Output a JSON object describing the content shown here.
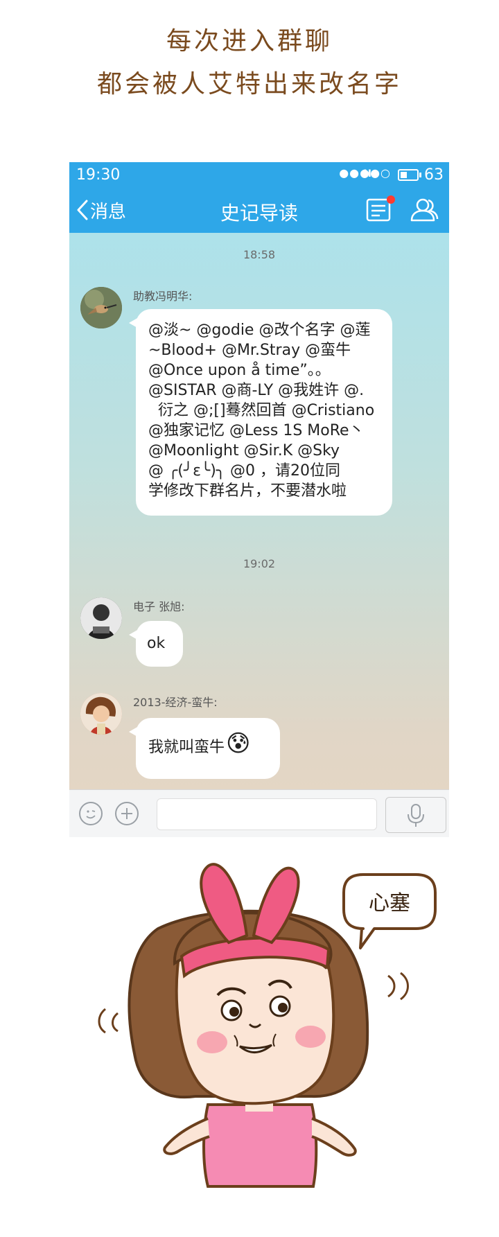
{
  "caption": {
    "line1": "每次进入群聊",
    "line2": "都会被人艾特出来改名字"
  },
  "status_bar": {
    "time": "19:30",
    "network": "H",
    "battery": "63"
  },
  "nav": {
    "back_label": "消息",
    "title": "史记导读",
    "icons": [
      "chevron-left-icon",
      "group-notice-icon",
      "group-members-icon"
    ]
  },
  "messages": [
    {
      "timestamp": "18:58",
      "sender": "助教冯明华:",
      "text": "@淡~ @godie @改个名字 @莲\n~Blood+ @Mr.Stray @蛮牛\n@Once upon å time”。。\n@SISTAR @商-LY @我姓许 @.\n  衍之 @;[]蓦然回首 @Cristiano\n@独家记忆 @Less 1S MoRe丶\n@Moonlight @Sir.K @Sky\n@ ╭(╯ε╰)╮ @0 ，请20位同\n学修改下群名片，不要潜水啦"
    },
    {
      "timestamp": "19:02",
      "sender": "电子 张旭:",
      "text": "ok"
    },
    {
      "sender": "2013-经济-蛮牛:",
      "text": "我就叫蛮牛",
      "emoji": "😰"
    }
  ],
  "input_bar": {
    "placeholder": "",
    "icons": [
      "emoji-icon",
      "plus-icon",
      "microphone-icon"
    ]
  },
  "illustration": {
    "speech_bubble": "心塞"
  },
  "colors": {
    "header_blue": "#2ea7e8",
    "caption_brown": "#7a4a1e",
    "notice_dot": "#ff3b30"
  }
}
